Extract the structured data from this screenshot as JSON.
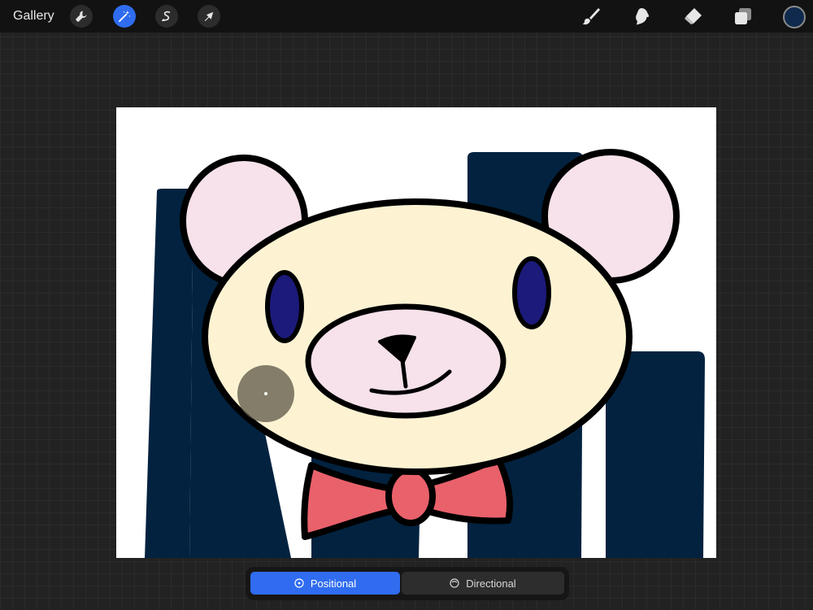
{
  "topbar": {
    "gallery_label": "Gallery",
    "left_tools": [
      {
        "icon": "wrench-icon",
        "active": false
      },
      {
        "icon": "magic-wand-icon",
        "active": true
      },
      {
        "icon": "selection-s-icon",
        "active": false
      },
      {
        "icon": "arrow-cursor-icon",
        "active": false
      }
    ],
    "right_tools": [
      "brush-icon",
      "smudge-icon",
      "eraser-icon",
      "layers-icon"
    ],
    "current_color": "#0f2a4d"
  },
  "liquify_modes": {
    "positional_label": "Positional",
    "directional_label": "Directional",
    "selected": "Positional"
  },
  "colors": {
    "accent": "#2f6cf0",
    "navy_stripes": "#02223f",
    "bear_face": "#fdf3d3",
    "bear_pink": "#f7e1ea",
    "bear_eyes": "#1c1a7a",
    "bow": "#e9616b"
  }
}
